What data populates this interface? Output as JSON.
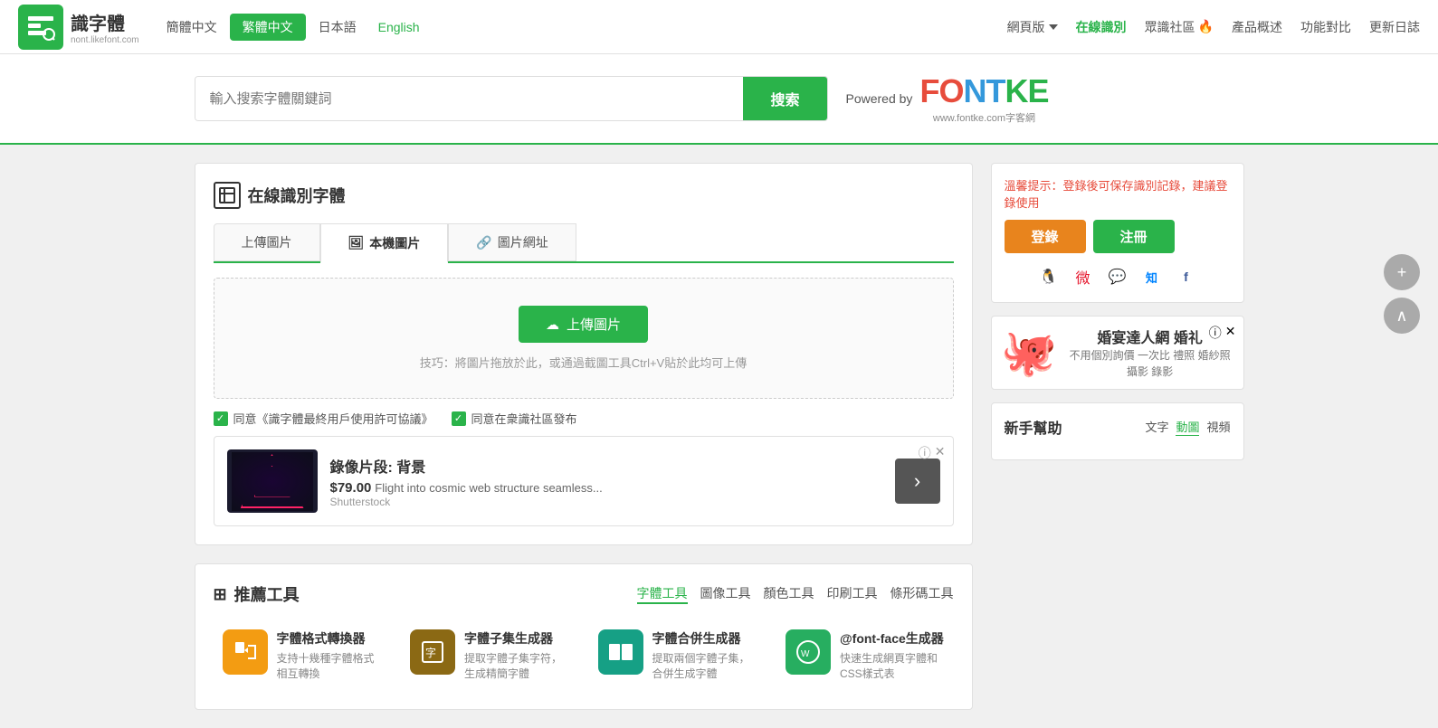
{
  "header": {
    "logo_text": "識字體",
    "logo_sub": "nont.likefont.com",
    "nav_lang": [
      {
        "label": "簡體中文",
        "active": false
      },
      {
        "label": "繁體中文",
        "active": true
      },
      {
        "label": "日本語",
        "active": false
      },
      {
        "label": "English",
        "active": false
      }
    ],
    "nav_main": [
      {
        "label": "網頁版",
        "dropdown": true
      },
      {
        "label": "在線識別",
        "highlight": true
      },
      {
        "label": "眾識社區",
        "fire": true
      },
      {
        "label": "產品概述"
      },
      {
        "label": "功能對比"
      },
      {
        "label": "更新日誌"
      }
    ]
  },
  "search": {
    "placeholder": "輸入搜索字體關鍵詞",
    "button_label": "搜索",
    "powered_by": "Powered by",
    "fontke_name": "FONTKE",
    "fontke_url": "www.fontke.com字客網"
  },
  "recognition": {
    "panel_title": "在線識別字體",
    "tabs": [
      {
        "label": "上傳圖片",
        "active": false
      },
      {
        "label": "本機圖片",
        "active": true,
        "icon": "image"
      },
      {
        "label": "圖片網址",
        "active": false,
        "icon": "link"
      }
    ],
    "upload_button": "上傳圖片",
    "upload_tip": "技巧：將圖片拖放於此，或通過截圖工具Ctrl+V貼於此均可上傳",
    "checkbox1": "同意《識字體最終用戶使用許可協議》",
    "checkbox2": "同意在衆識社區發布"
  },
  "ad_banner": {
    "title": "錄像片段: 背景",
    "price": "$79.00",
    "desc": "Flight into cosmic web structure seamless...",
    "source": "Shutterstock",
    "info_icon": "ⓘ",
    "close_icon": "✕"
  },
  "tools": {
    "section_title": "推薦工具",
    "title_icon": "grid",
    "nav_items": [
      {
        "label": "字體工具",
        "active": true
      },
      {
        "label": "圖像工具"
      },
      {
        "label": "顏色工具"
      },
      {
        "label": "印刷工具"
      },
      {
        "label": "條形碼工具"
      }
    ],
    "items": [
      {
        "name": "字體格式轉換器",
        "desc": "支持十幾種字體格式相互轉換",
        "color": "orange"
      },
      {
        "name": "字體子集生成器",
        "desc": "提取字體子集字符，生成精簡字體",
        "color": "yellow-brown"
      },
      {
        "name": "字體合併生成器",
        "desc": "提取兩個字體子集，合併生成字體",
        "color": "teal"
      },
      {
        "name": "@font-face生成器",
        "desc": "快速生成網頁字體和CSS樣式表",
        "color": "green-dark"
      }
    ]
  },
  "sidebar": {
    "login_tip": "溫馨提示：登錄後可保存識別記錄，建議登錄使用",
    "login_btn": "登錄",
    "register_btn": "注冊",
    "social_icons": [
      "QQ",
      "微博",
      "微信",
      "知乎",
      "Facebook"
    ],
    "ad": {
      "title": "婚宴達人網 婚礼",
      "desc": "不用個別詢價 一次比\n禮照 婚紗照 攝影 錄影",
      "info_icon": "ⓘ",
      "close_icon": "✕"
    },
    "help": {
      "title": "新手幫助",
      "tabs": [
        {
          "label": "文字"
        },
        {
          "label": "動圖",
          "active": true
        },
        {
          "label": "視頻"
        }
      ]
    }
  },
  "floating": {
    "plus_icon": "+",
    "up_icon": "∧"
  }
}
